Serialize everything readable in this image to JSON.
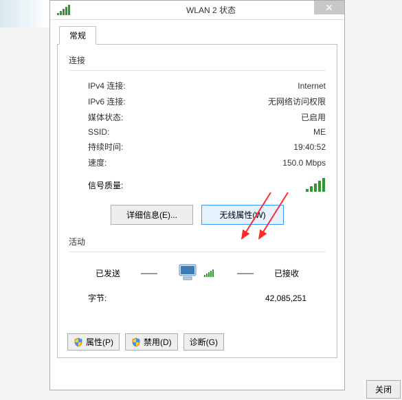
{
  "titlebar": {
    "title": "WLAN 2 状态"
  },
  "tabs": {
    "general": "常规"
  },
  "sections": {
    "connection": "连接",
    "activity": "活动"
  },
  "connection": {
    "ipv4_label": "IPv4 连接:",
    "ipv4_value": "Internet",
    "ipv6_label": "IPv6 连接:",
    "ipv6_value": "无网络访问权限",
    "media_label": "媒体状态:",
    "media_value": "已启用",
    "ssid_label": "SSID:",
    "ssid_value": "ME",
    "duration_label": "持续时间:",
    "duration_value": "19:40:52",
    "speed_label": "速度:",
    "speed_value": "150.0 Mbps",
    "signal_label": "信号质量:"
  },
  "buttons": {
    "details": "详细信息(E)...",
    "wireless_props": "无线属性(W)",
    "properties": "属性(P)",
    "disable": "禁用(D)",
    "diagnose": "诊断(G)",
    "close": "关闭"
  },
  "activity": {
    "sent_label": "已发送",
    "recv_label": "已接收",
    "bytes_label": "字节:",
    "recv_value": "42,085,251"
  }
}
